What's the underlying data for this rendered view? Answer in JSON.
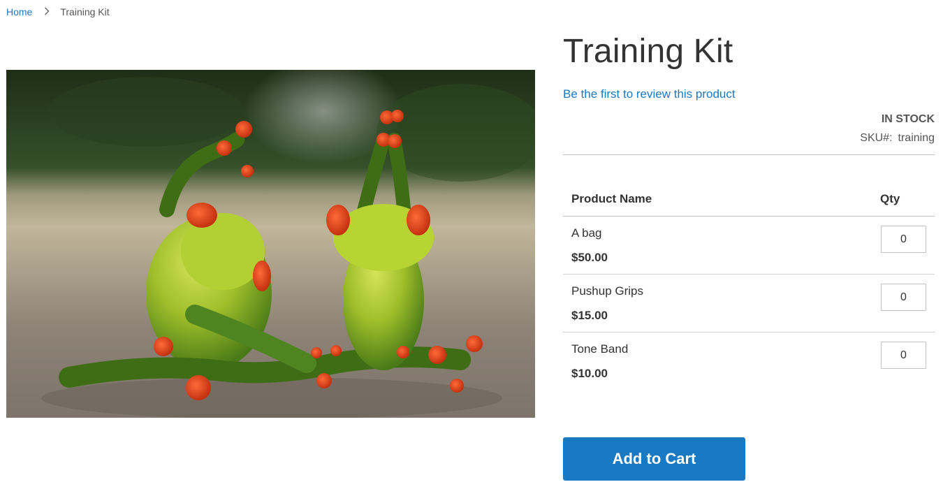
{
  "breadcrumb": {
    "home": "Home",
    "separator": "›",
    "current": "Training Kit"
  },
  "product": {
    "title": "Training Kit",
    "review_link": "Be the first to review this product",
    "stock": "In stock",
    "sku_label": "SKU#:",
    "sku_value": "training",
    "image_alt": "Two green frog figurines doing yoga"
  },
  "table": {
    "col_name": "Product Name",
    "col_qty": "Qty",
    "items": [
      {
        "name": "A bag",
        "price": "$50.00",
        "qty": "0"
      },
      {
        "name": "Pushup Grips",
        "price": "$15.00",
        "qty": "0"
      },
      {
        "name": "Tone Band",
        "price": "$10.00",
        "qty": "0"
      }
    ]
  },
  "actions": {
    "add_to_cart": "Add to Cart"
  },
  "colors": {
    "accent": "#1979c3",
    "text": "#333333"
  }
}
